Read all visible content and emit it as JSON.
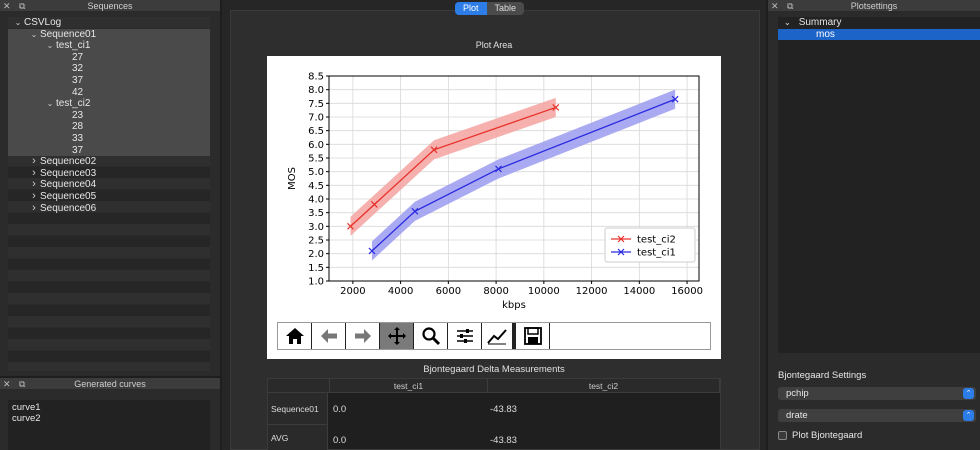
{
  "sequences_panel": {
    "title": "Sequences",
    "tree": [
      {
        "label": "CSVLog",
        "depth": 0,
        "arrow": "v",
        "selected": false
      },
      {
        "label": "Sequence01",
        "depth": 1,
        "arrow": "v",
        "selected": true
      },
      {
        "label": "test_ci1",
        "depth": 2,
        "arrow": "v",
        "selected": true
      },
      {
        "label": "27",
        "depth": 3,
        "arrow": "",
        "selected": true
      },
      {
        "label": "32",
        "depth": 3,
        "arrow": "",
        "selected": true
      },
      {
        "label": "37",
        "depth": 3,
        "arrow": "",
        "selected": true
      },
      {
        "label": "42",
        "depth": 3,
        "arrow": "",
        "selected": true
      },
      {
        "label": "test_ci2",
        "depth": 2,
        "arrow": "v",
        "selected": true
      },
      {
        "label": "23",
        "depth": 3,
        "arrow": "",
        "selected": true
      },
      {
        "label": "28",
        "depth": 3,
        "arrow": "",
        "selected": true
      },
      {
        "label": "33",
        "depth": 3,
        "arrow": "",
        "selected": true
      },
      {
        "label": "37",
        "depth": 3,
        "arrow": "",
        "selected": true
      },
      {
        "label": "Sequence02",
        "depth": 1,
        "arrow": ">",
        "selected": false
      },
      {
        "label": "Sequence03",
        "depth": 1,
        "arrow": ">",
        "selected": false
      },
      {
        "label": "Sequence04",
        "depth": 1,
        "arrow": ">",
        "selected": false
      },
      {
        "label": "Sequence05",
        "depth": 1,
        "arrow": ">",
        "selected": false
      },
      {
        "label": "Sequence06",
        "depth": 1,
        "arrow": ">",
        "selected": false
      }
    ]
  },
  "curves_panel": {
    "title": "Generated curves",
    "items": [
      "curve1",
      "curve2"
    ]
  },
  "center": {
    "tabs": [
      {
        "label": "Plot",
        "active": true
      },
      {
        "label": "Table",
        "active": false
      }
    ],
    "plot_area_title": "Plot Area",
    "toolbar": [
      "home-icon",
      "back-arrow-icon",
      "forward-arrow-icon",
      "pan-icon",
      "zoom-icon",
      "configure-subplots-icon",
      "edit-axis-icon",
      "save-icon"
    ],
    "bjontegaard": {
      "title": "Bjontegaard Delta Measurements",
      "columns": [
        "test_ci1",
        "test_ci2"
      ],
      "rows": [
        {
          "label": "Sequence01",
          "values": [
            "0.0",
            "-43.83"
          ]
        },
        {
          "label": "AVG",
          "values": [
            "0.0",
            "-43.83"
          ]
        }
      ]
    }
  },
  "chart_data": {
    "type": "line",
    "xlabel": "kbps",
    "ylabel": "MOS",
    "xlim": [
      1000,
      16500
    ],
    "ylim": [
      1.0,
      8.5
    ],
    "xticks": [
      2000,
      4000,
      6000,
      8000,
      10000,
      12000,
      14000,
      16000
    ],
    "yticks": [
      1.0,
      1.5,
      2.0,
      2.5,
      3.0,
      3.5,
      4.0,
      4.5,
      5.0,
      5.5,
      6.0,
      6.5,
      7.0,
      7.5,
      8.0,
      8.5
    ],
    "grid": true,
    "legend": "bottom-right",
    "series": [
      {
        "name": "test_ci2",
        "color": "#e8302a",
        "band_color": "#f4a3a0",
        "x": [
          1900,
          2900,
          5400,
          10500
        ],
        "y": [
          3.0,
          3.8,
          5.8,
          7.35
        ],
        "band": 0.35
      },
      {
        "name": "test_ci1",
        "color": "#2a2ae0",
        "band_color": "#9b9bf0",
        "x": [
          2800,
          4600,
          8100,
          15500
        ],
        "y": [
          2.1,
          3.55,
          5.1,
          7.65
        ],
        "band": 0.35
      }
    ]
  },
  "right_panel": {
    "title": "Plotsettings",
    "tree": [
      {
        "label": "Summary",
        "depth": 0,
        "arrow": "v",
        "selected": false
      },
      {
        "label": "mos",
        "depth": 1,
        "arrow": "",
        "selected": true
      }
    ],
    "bj_settings_label": "Bjontegaard Settings",
    "interp_combo": "pchip",
    "mode_combo": "drate",
    "plot_bj_label": "Plot Bjontegaard",
    "plot_bj_checked": false
  },
  "colors": {
    "accent": "#2d7de8",
    "selection": "#1d64c9"
  }
}
